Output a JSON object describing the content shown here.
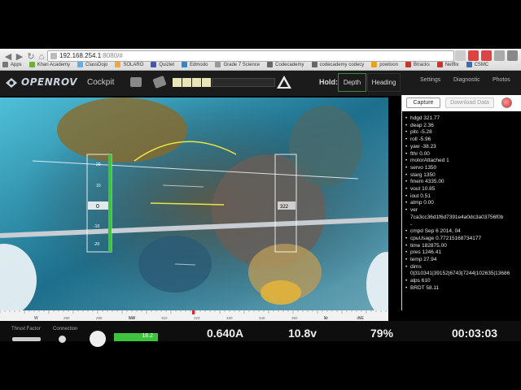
{
  "browser": {
    "url_host": "192.168.254.1",
    "url_rest": ":8080/#",
    "bookmarks": [
      {
        "label": "Apps",
        "color": "#777"
      },
      {
        "label": "Khan Academy",
        "color": "#6fae3a"
      },
      {
        "label": "ClassDojo",
        "color": "#5fb0e0"
      },
      {
        "label": "SOLARO",
        "color": "#f2a73b"
      },
      {
        "label": "Quizlet",
        "color": "#4257b2"
      },
      {
        "label": "Edmodo",
        "color": "#2e88c8"
      },
      {
        "label": "Grade 7 Science",
        "color": "#999"
      },
      {
        "label": "Codecademy",
        "color": "#666"
      },
      {
        "label": "codecademy codecy",
        "color": "#666"
      },
      {
        "label": "powtoon",
        "color": "#e8a21c"
      },
      {
        "label": "Btracks",
        "color": "#c0392b"
      },
      {
        "label": "Netflix",
        "color": "#d32f2f"
      },
      {
        "label": "CSMC",
        "color": "#3a6fb0"
      }
    ]
  },
  "header": {
    "logo": "OPENROV",
    "app_name": "Cockpit",
    "hold_label": "Hold:",
    "hold_depth": "Depth",
    "hold_heading": "Heading",
    "settings": "Settings",
    "diagnostic": "Diagnostic",
    "photos": "Photos",
    "battery_level": 0.35
  },
  "panel": {
    "capture": "Capture",
    "download": "Download Data",
    "telemetry": [
      "hdgd 321.77",
      "deap 2.36",
      "pitc -5.28",
      "roll -5.96",
      "yaw -38.23",
      "fthr 0.00",
      "motorAttached 1",
      "servo 1350",
      "starg 1350",
      "fmem 4335.00",
      "vout 10.85",
      "iout 0.51",
      "atmp 0.00",
      "ver",
      "7ca3cc36d1f6d7391e4a0dc3a03756f0b",
      "-",
      "cmpd Sep 6 2014, 04",
      "cpuUsage 0.77215168734177",
      "time 182875.00",
      "pres 1246.41",
      "temp 27.94",
      "dims",
      "0|310341|39152|6743|7244|102635|13686",
      "alps 610",
      "BRDT 58.11"
    ]
  },
  "hud": {
    "depth_tape_value": "0",
    "heading_tape_value": "322",
    "depth_ticks": [
      "20",
      "10",
      "0",
      "-10",
      "-20"
    ]
  },
  "compass": {
    "labels": [
      "W",
      "NW",
      "N",
      "NE"
    ],
    "numbers": [
      "280",
      "290",
      "300",
      "310",
      "320",
      "330",
      "340",
      "350",
      "10",
      "20",
      "30"
    ]
  },
  "footer": {
    "thrust_factor": "Thrust Factor",
    "connection": "Connection",
    "current": "0.640A",
    "voltage": "10.8v",
    "battery_percent": "79%",
    "time": "00:03:03",
    "green_value": "18.2"
  }
}
